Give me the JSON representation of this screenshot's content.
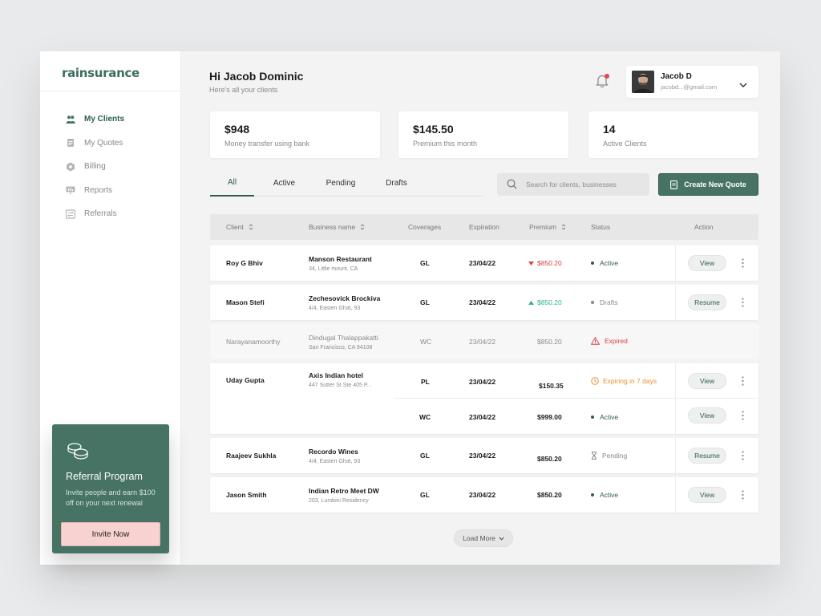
{
  "brand": {
    "logo": "rainsurance"
  },
  "sidebar": {
    "items": [
      {
        "label": "My Clients",
        "icon": "users-icon"
      },
      {
        "label": "My Quotes",
        "icon": "document-icon"
      },
      {
        "label": "Billing",
        "icon": "hexagon-icon"
      },
      {
        "label": "Reports",
        "icon": "presentation-icon"
      },
      {
        "label": "Referrals",
        "icon": "transfer-icon"
      }
    ]
  },
  "referral": {
    "title": "Referral Program",
    "description": "Invite people and earn $100 off on your next renewal",
    "button": "Invite Now"
  },
  "header": {
    "greeting": "Hi Jacob Dominic",
    "subtitle": "Here's all your clients"
  },
  "user": {
    "name": "Jacob D",
    "email": "jacobd...@gmail.com"
  },
  "stats": [
    {
      "value": "$948",
      "label": "Money transfer using bank"
    },
    {
      "value": "$145.50",
      "label": "Premium this month"
    },
    {
      "value": "14",
      "label": "Active Clients"
    }
  ],
  "tabs": [
    "All",
    "Active",
    "Pending",
    "Drafts"
  ],
  "search": {
    "placeholder": "Search for clients, businesses"
  },
  "create_button": "Create New Quote",
  "table": {
    "columns": {
      "client": "Client",
      "business": "Business name",
      "coverages": "Coverages",
      "expiration": "Expiration",
      "premium": "Premium",
      "status": "Status",
      "action": "Action"
    },
    "rows": [
      {
        "client": "Roy G Bhiv",
        "business": "Manson Restaurant",
        "address": "34, Little mount, CA",
        "coverage": "GL",
        "expiration": "23/04/22",
        "premium": "$850.20",
        "status": "Active",
        "action": "View"
      },
      {
        "client": "Mason Stefi",
        "business": "Zechesovick Brockiva",
        "address": "4/4, Easten Ghat, 93",
        "coverage": "GL",
        "expiration": "23/04/22",
        "premium": "$850.20",
        "status": "Drafts",
        "action": "Resume"
      },
      {
        "client": "Narayanamoorthy",
        "business": "Dindugal Thalappakatti",
        "address": "San Francisco, CA 94108",
        "coverage": "WC",
        "expiration": "23/04/22",
        "premium": "$850.20",
        "status": "Expired"
      },
      {
        "client": "Uday Gupta",
        "business": "Axis Indian hotel",
        "address": "447 Sutter St Ste 405 P...",
        "coverage": "PL",
        "expiration": "23/04/22",
        "premium": "$150.35",
        "status": "Expiring in 7 days",
        "action": "View",
        "coverage2": "WC",
        "expiration2": "23/04/22",
        "premium2": "$999.00",
        "status2": "Active",
        "action2": "View"
      },
      {
        "client": "Raajeev Sukhla",
        "business": "Recordo Wines",
        "address": "4/4, Easten Ghat, 93",
        "coverage": "GL",
        "expiration": "23/04/22",
        "premium": "$850.20",
        "status": "Pending",
        "action": "Resume"
      },
      {
        "client": "Jason Smith",
        "business": "Indian Retro Meet DW",
        "address": "203, Lumbini Residency",
        "coverage": "GL",
        "expiration": "23/04/22",
        "premium": "$850.20",
        "status": "Active",
        "action": "View"
      }
    ]
  },
  "load_more": "Load More",
  "colors": {
    "brand": "#477365",
    "active": "#2f5d4d",
    "down": "#d64545",
    "up": "#2bb38a",
    "warning": "#e8912d",
    "expired": "#d64545"
  }
}
